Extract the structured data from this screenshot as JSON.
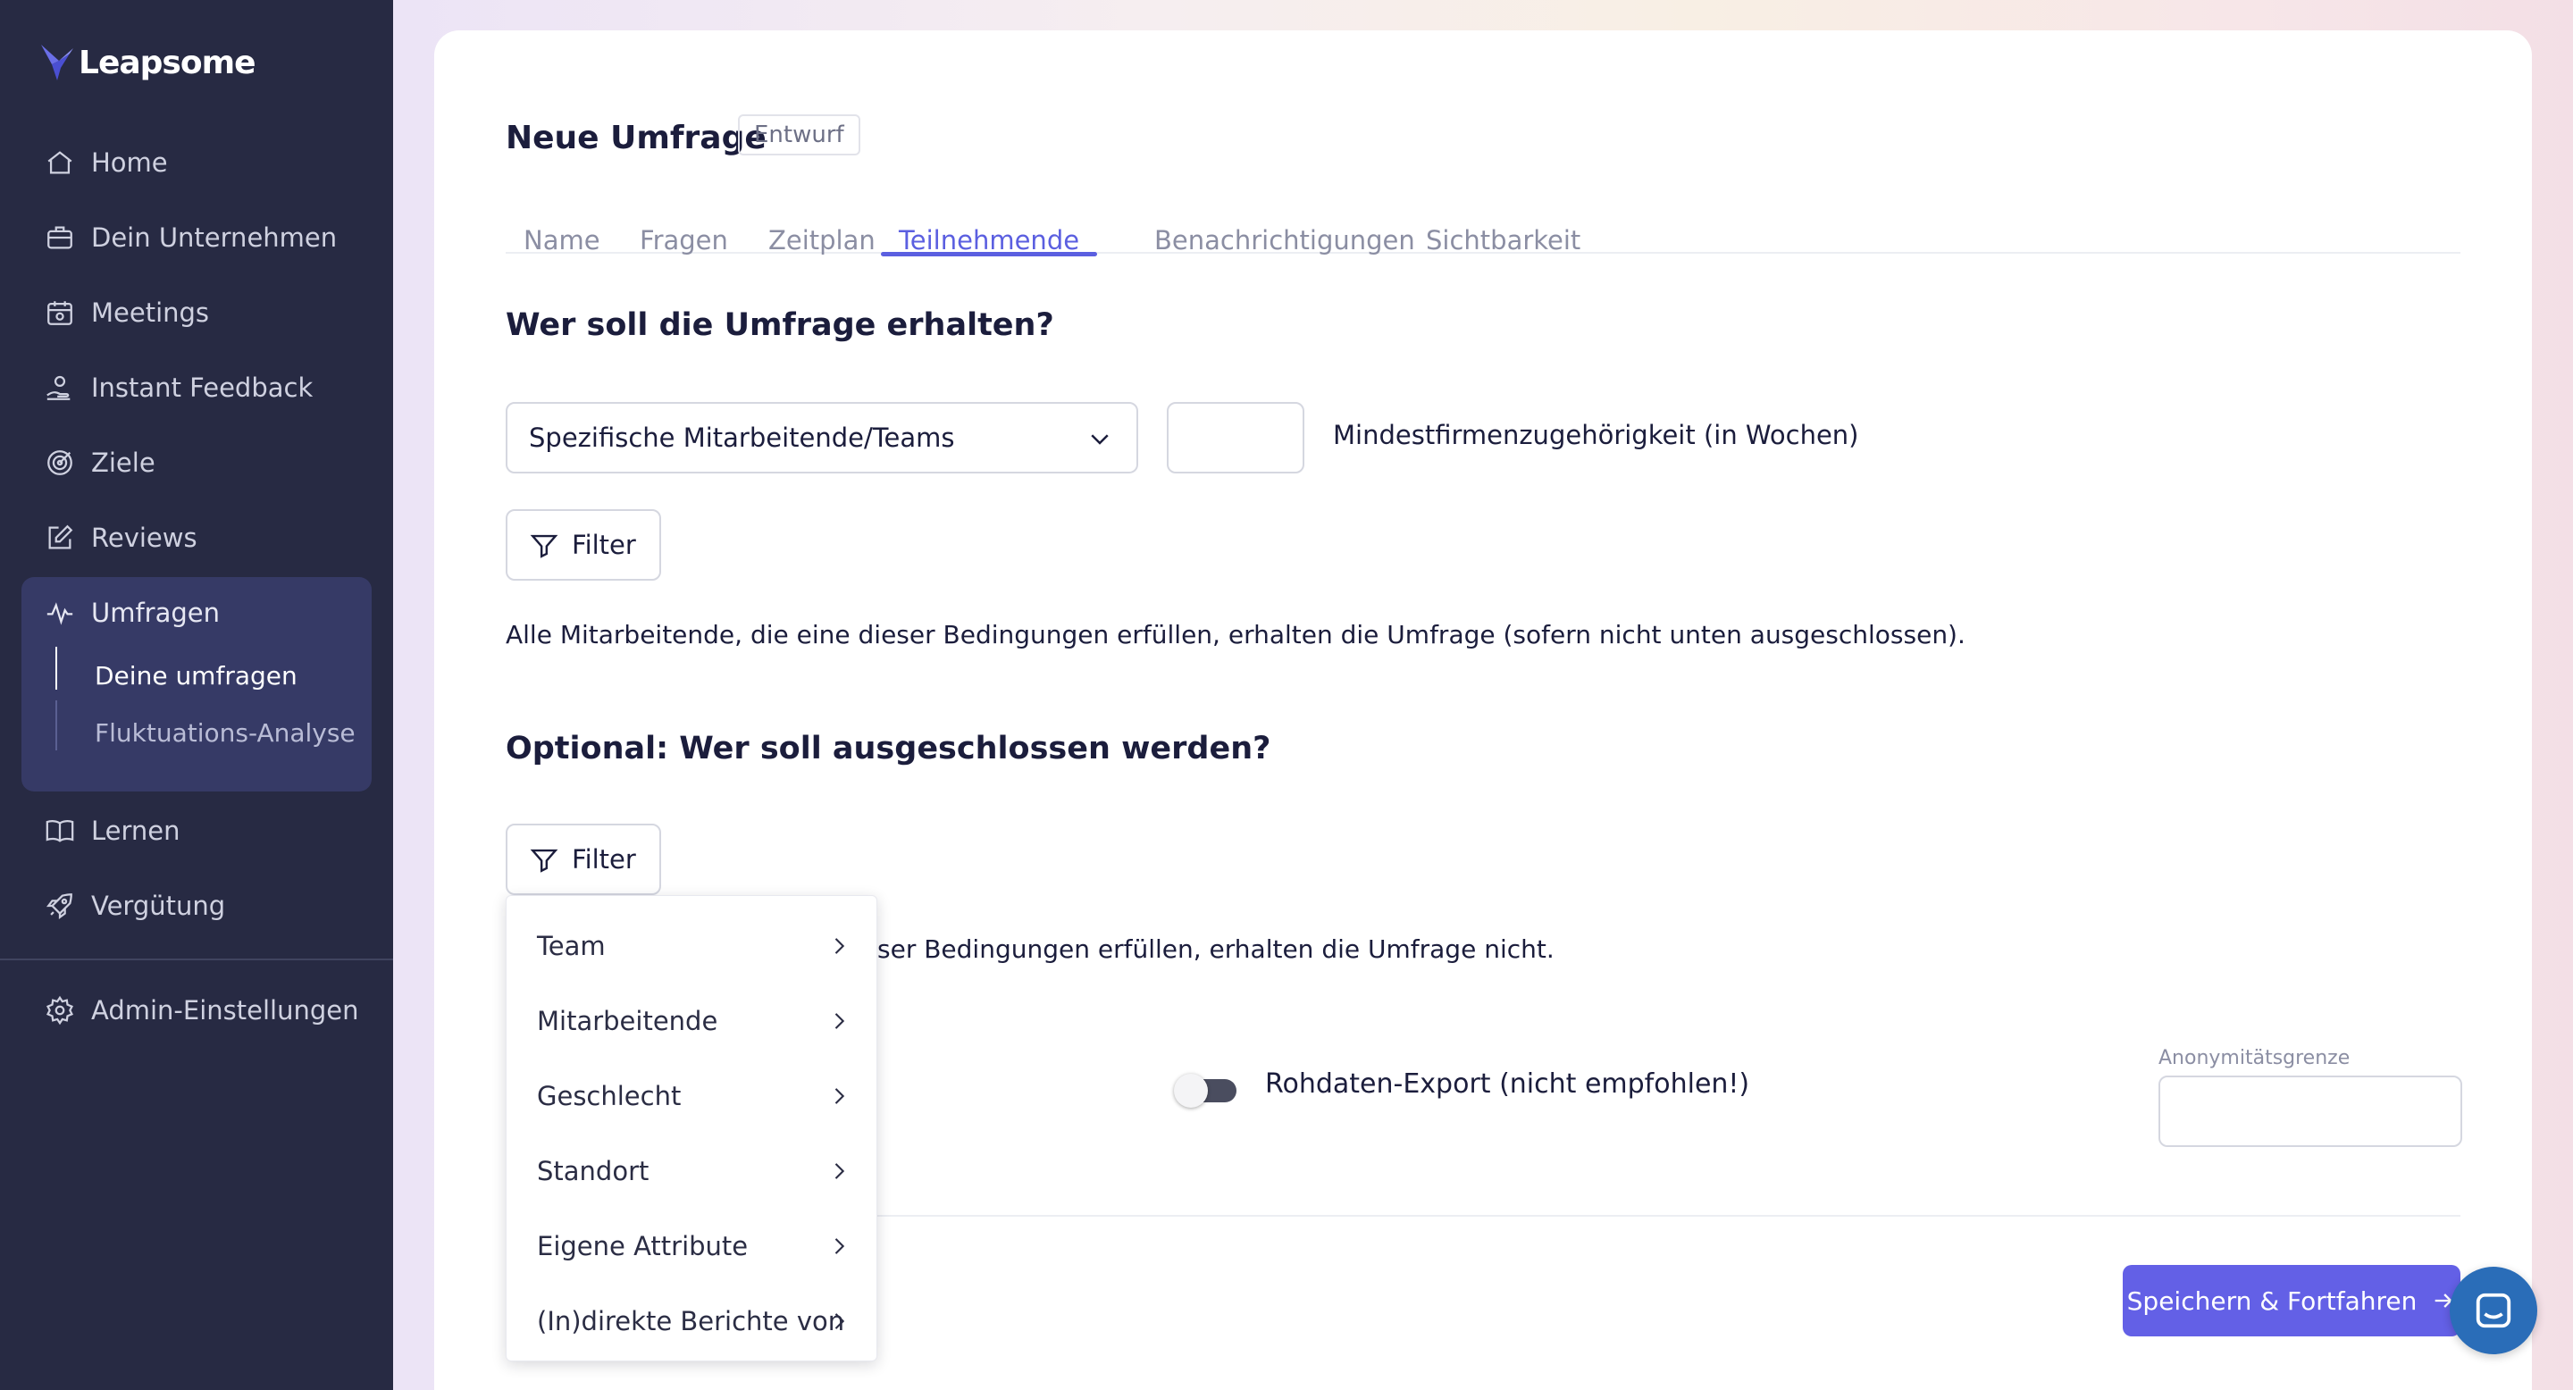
{
  "app": {
    "name": "Leapsome"
  },
  "sidebar": {
    "items": [
      {
        "label": "Home",
        "icon": "home-icon"
      },
      {
        "label": "Dein Unternehmen",
        "icon": "briefcase-icon"
      },
      {
        "label": "Meetings",
        "icon": "calendar-icon"
      },
      {
        "label": "Instant Feedback",
        "icon": "hand-feedback-icon"
      },
      {
        "label": "Ziele",
        "icon": "target-icon"
      },
      {
        "label": "Reviews",
        "icon": "edit-icon"
      },
      {
        "label": "Umfragen",
        "icon": "pulse-icon"
      },
      {
        "label": "Lernen",
        "icon": "book-icon"
      },
      {
        "label": "Vergütung",
        "icon": "rocket-icon"
      },
      {
        "label": "Admin-Einstellungen",
        "icon": "gear-icon"
      }
    ],
    "sub_items": [
      {
        "label": "Deine umfragen",
        "active": true
      },
      {
        "label": "Fluktuations-Analyse",
        "active": false
      }
    ]
  },
  "page": {
    "title": "Neue Umfrage",
    "status": "Entwurf",
    "tabs": [
      {
        "label": "Name",
        "active": false
      },
      {
        "label": "Fragen",
        "active": false
      },
      {
        "label": "Zeitplan",
        "active": false
      },
      {
        "label": "Teilnehmende",
        "active": true
      },
      {
        "label": "Benachrichtigungen",
        "active": false
      },
      {
        "label": "Sichtbarkeit",
        "active": false
      }
    ]
  },
  "recipients": {
    "heading": "Wer soll die Umfrage erhalten?",
    "select_value": "Spezifische Mitarbeitende/Teams",
    "tenure_value": "",
    "tenure_label": "Mindestfirmenzugehörigkeit (in Wochen)",
    "filter_label": "Filter",
    "info": "Alle Mitarbeitende, die eine dieser Bedingungen erfüllen, erhalten die Umfrage (sofern nicht unten ausgeschlossen)."
  },
  "exclusions": {
    "heading": "Optional: Wer soll ausgeschlossen werden?",
    "filter_label": "Filter",
    "info_visible": "ser Bedingungen erfüllen, erhalten die Umfrage nicht."
  },
  "filter_menu": {
    "items": [
      "Team",
      "Mitarbeitende",
      "Geschlecht",
      "Standort",
      "Eigene Attribute",
      "(In)direkte Berichte von"
    ]
  },
  "options": {
    "raw_export_label": "Rohdaten-Export (nicht empfohlen!)",
    "raw_export_enabled": false,
    "anonymity_caption": "Anonymitätsgrenze",
    "anonymity_value": ""
  },
  "footer": {
    "primary_label": "Speichern & Fortfahren"
  },
  "colors": {
    "sidebar_bg": "#272a43",
    "accent": "#5b5fe0",
    "primary_button": "#6360e6",
    "chat_button": "#2a6db8"
  }
}
